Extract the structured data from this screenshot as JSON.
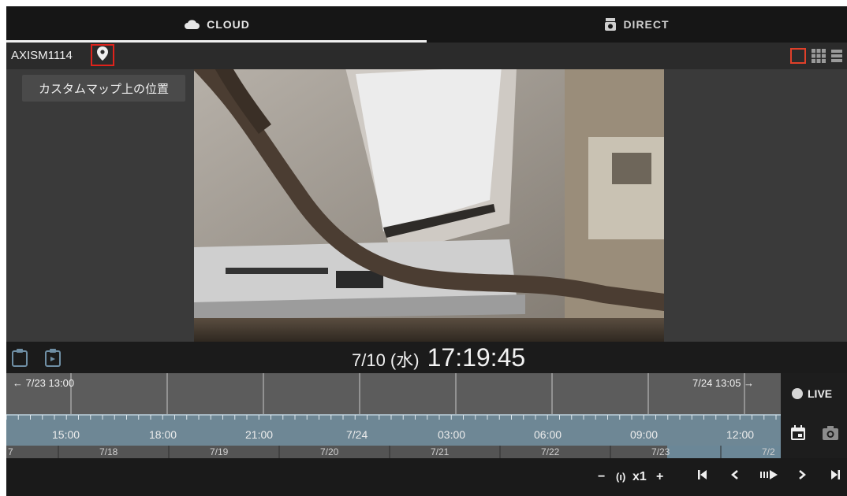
{
  "tabs": {
    "cloud": "CLOUD",
    "direct": "DIRECT"
  },
  "camera": {
    "name": "AXISM1114"
  },
  "tooltip": {
    "text": "カスタムマップ上の位置"
  },
  "playback": {
    "date": "7/10 (水)",
    "time": "17:19:45",
    "speed": "x1"
  },
  "timeline": {
    "range_start": "← 7/23 13:00",
    "range_end": "7/24 13:05 →",
    "hours": [
      "15:00",
      "18:00",
      "21:00",
      "7/24",
      "03:00",
      "06:00",
      "09:00",
      "12:00"
    ],
    "days": [
      "7",
      "7/18",
      "7/19",
      "7/20",
      "7/21",
      "7/22",
      "7/23",
      "7/2"
    ]
  },
  "live": {
    "label": "LIVE"
  },
  "colors": {
    "accent_red": "#e0221b",
    "timeline_band": "#6e8795"
  },
  "icons": [
    "cloud-icon",
    "camera-icon",
    "location-pin-icon",
    "single-view-icon",
    "grid-view-icon",
    "list-view-icon",
    "clipboard-icon",
    "clip-export-icon",
    "calendar-icon",
    "snapshot-icon"
  ]
}
